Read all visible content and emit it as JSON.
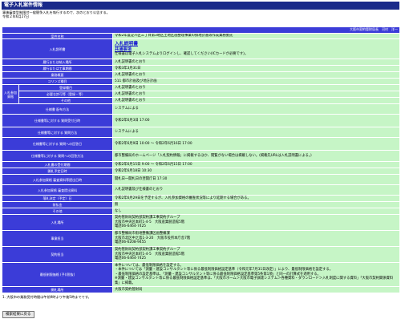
{
  "window": {
    "title": "電子入札案件情報"
  },
  "intro": {
    "line1": "事後審査型制限付一般競争入札を執行するので、次のとおり公告する。",
    "line2": "令和２年6月27日"
  },
  "dept": {
    "name": "大阪市契約管財局長　河村　洋一"
  },
  "rows": [
    {
      "label": "案件名称",
      "value": "令和2年度淀川区三丁目第3地区土地区画整理事業の換地計画等作成業務委託"
    },
    {
      "label": "入札説明書",
      "link1": "入札説明書",
      "link2": "共通事項",
      "value": "仕様書は電子入札システムよりログインし、確認してください(ICカードが必要です)。"
    },
    {
      "label": "履行または納入場所",
      "value": "入札説明書のとおり"
    },
    {
      "label": "履行または工事期間",
      "value": "令和3年3月31日"
    },
    {
      "label": "業務概要",
      "value": "入札説明書のとおり"
    },
    {
      "label": "コリンズ種目",
      "value": "511 都市計画及び地方計画"
    }
  ],
  "sidebar_label": "入札参加資格",
  "sub_rows": [
    {
      "label": "登録種目",
      "value": "入札説明書のとおり"
    },
    {
      "label": "必要な許可等（登録・等）",
      "value": "入札説明書のとおり"
    },
    {
      "label": "その他",
      "value": "入札説明書のとおり"
    }
  ],
  "rows2": [
    {
      "label": "仕様書 配布方法",
      "value": "システムによる"
    },
    {
      "label": "仕様書等に対する 質問受付日時",
      "value": "令和2年6月3日 17:00"
    },
    {
      "label": "仕様書等に対する 質問方法",
      "value": "システムによる"
    },
    {
      "label": "仕様書等に対する 質問への回答日",
      "value": "令和2年6月9日 10:00 ～ 令和2年6月16日 17:00"
    },
    {
      "label": "仕様書等に対する 質問への回答方法",
      "value": "都市整備局のホームページ「入札契約情報」に掲載するほか、閲覧がない場合は掲載しない。(掲載先URLは入札説明書による。)"
    },
    {
      "label": "入札書の受付期間",
      "value": "令和2年6月15日 9:00 ～ 令和2年6月15日 17:00"
    },
    {
      "label": "開札予定日時",
      "value": "令和2年6月18日 10:30"
    },
    {
      "label": "入札参加資格 審査資料等提出日時",
      "value": "開札日一開札日の翌開庁日 17:30"
    },
    {
      "label": "入札参加資格 審査提出資料",
      "value": "入札説明書及び仕様書のとおり"
    },
    {
      "label": "落札決定（予定）日",
      "value": "令和2年6月29日を予定するが、入札参加資格の審査状況等により延期する場合がある。"
    },
    {
      "label": "前払金",
      "value": "無"
    },
    {
      "label": "その他",
      "value": "なし"
    },
    {
      "label": "入札場所",
      "lines": [
        "契約管財局契約部契約課工事契約グループ",
        "大阪市中央区本町1-4-5　大阪産業創造館5階",
        "電話06-6464-7425"
      ]
    },
    {
      "label": "事業担当",
      "lines": [
        "都市整備局市街地整備課区画整備課",
        "大阪市北区中之島1-3-20　大阪市役所本庁舎7階",
        "電話06-6208-9455"
      ]
    },
    {
      "label": "契約担当",
      "lines": [
        "契約管財局契約部契約課工事契約グループ",
        "大阪市中央区本町1-4-5　大阪産業創造館5階",
        "電話06-6464-7425"
      ]
    },
    {
      "label": "最低制限価格 (予)(税抜)",
      "lines": [
        "本件については、最低制限価格を設定する。",
        "・本件については「測量・建設コンサルタント等に係る最低制限価格設定基準（令和元年7月31日改定）」により、最低制限価格を設定する。",
        "・最低制限価格の設定基準は、「測量・建設コンサルタント等に係る最低制限価格設定基準第5条第1項」と同一の計算式を適用する。",
        "※測量・建設コンサルタント等に係る最低制限価格設定基準は、「大阪市ホーム＞大阪市電子調達システム＞各種資料・ダウンロード＞入札制度に関する資料」「大阪市契約関係資料集」に掲載。"
      ]
    },
    {
      "label": "開札場所",
      "value": "大阪市契約管財局"
    }
  ],
  "footnote": "1. 大阪市の業務受付時間は午前9時より午後5時までです。",
  "back_button": "検索結果に戻る"
}
